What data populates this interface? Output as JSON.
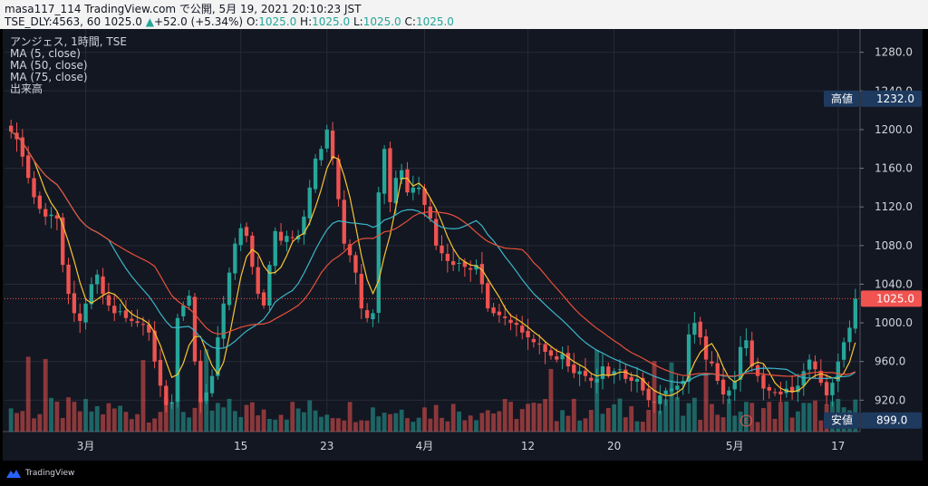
{
  "header": {
    "line1": "masa117_114 TradingView.com で公開, 5月 19, 2021 20:10:23 JST",
    "symbol": "TSE_DLY:4563, 60",
    "last": "1025.0",
    "change_arrow": "▲",
    "change": "+52.0 (+5.34%)",
    "o_label": "O:",
    "o_value": "1025.0",
    "h_label": "H:",
    "h_value": "1025.0",
    "l_label": "L:",
    "l_value": "1025.0",
    "c_label": "C:",
    "c_value": "1025.0"
  },
  "legend": {
    "line1": "アンジェス, 1時間, TSE",
    "line2": "MA (5, close)",
    "line3": "MA (50, close)",
    "line4": "MA (75, close)",
    "line5": "出来高"
  },
  "colors": {
    "up": "#26a69a",
    "down": "#ef5350",
    "ma5": "#f7c530",
    "ma50": "#3bb5c8",
    "ma75": "#e8503a",
    "background": "#131722",
    "grid": "#262a36",
    "axis_text": "#d1d4dc",
    "price_label": "#f05350",
    "hilo_label": "#1e3a5f"
  },
  "footer": {
    "brand": "TradingView",
    "icon": "tradingview-logo-icon"
  },
  "chart_data": {
    "type": "candlestick",
    "title": "アンジェス, 1時間, TSE",
    "interval": "60",
    "ylim": [
      880,
      1300
    ],
    "y_ticks": [
      920,
      960,
      1000,
      1040,
      1080,
      1120,
      1160,
      1200,
      1240,
      1280
    ],
    "y_tick_labels": [
      "920.0",
      "960.0",
      "1000.0",
      "1040.0",
      "1080.0",
      "1120.0",
      "1160.0",
      "1200.0",
      "1240.0",
      "1280.0"
    ],
    "x_labels": [
      {
        "label": "3月",
        "index": 13
      },
      {
        "label": "15",
        "index": 40
      },
      {
        "label": "23",
        "index": 55
      },
      {
        "label": "4月",
        "index": 72
      },
      {
        "label": "12",
        "index": 90
      },
      {
        "label": "20",
        "index": 105
      },
      {
        "label": "5月",
        "index": 126
      },
      {
        "label": "17",
        "index": 144
      }
    ],
    "grid": true,
    "last_price": 1025.0,
    "last_price_label": "1025.0",
    "high_label": "高値",
    "high_value": 1232.0,
    "high_value_label": "1232.0",
    "low_label": "安値",
    "low_value": 899.0,
    "low_value_label": "899.0",
    "series": [
      {
        "name": "MA (5, close)",
        "color": "#f7c530"
      },
      {
        "name": "MA (50, close)",
        "color": "#3bb5c8"
      },
      {
        "name": "MA (75, close)",
        "color": "#e8503a"
      },
      {
        "name": "出来高",
        "type": "volume"
      }
    ],
    "closes": [
      1198,
      1190,
      1172,
      1150,
      1130,
      1118,
      1110,
      1112,
      1108,
      1060,
      1030,
      1010,
      1002,
      1020,
      1040,
      1050,
      1030,
      1018,
      1010,
      1012,
      1005,
      1002,
      1000,
      998,
      990,
      960,
      935,
      915,
      918,
      1005,
      1018,
      1028,
      960,
      918,
      928,
      945,
      985,
      1020,
      1052,
      1082,
      1098,
      1090,
      1058,
      1030,
      1018,
      1060,
      1095,
      1085,
      1090,
      1088,
      1090,
      1110,
      1140,
      1170,
      1180,
      1200,
      1170,
      1128,
      1082,
      1070,
      1052,
      1015,
      1005,
      1010,
      1135,
      1180,
      1125,
      1150,
      1158,
      1135,
      1140,
      1140,
      1122,
      1108,
      1080,
      1072,
      1064,
      1060,
      1062,
      1058,
      1055,
      1060,
      1040,
      1015,
      1010,
      1008,
      1005,
      1000,
      998,
      990,
      985,
      980,
      978,
      970,
      966,
      962,
      968,
      955,
      948,
      950,
      945,
      940,
      942,
      955,
      946,
      950,
      952,
      942,
      940,
      942,
      930,
      920,
      918,
      925,
      930,
      932,
      935,
      940,
      988,
      1000,
      985,
      962,
      958,
      940,
      926,
      930,
      940,
      975,
      982,
      955,
      945,
      932,
      930,
      928,
      926,
      932,
      928,
      935,
      950,
      962,
      952,
      938,
      925,
      938,
      960,
      980,
      995,
      1025
    ]
  }
}
